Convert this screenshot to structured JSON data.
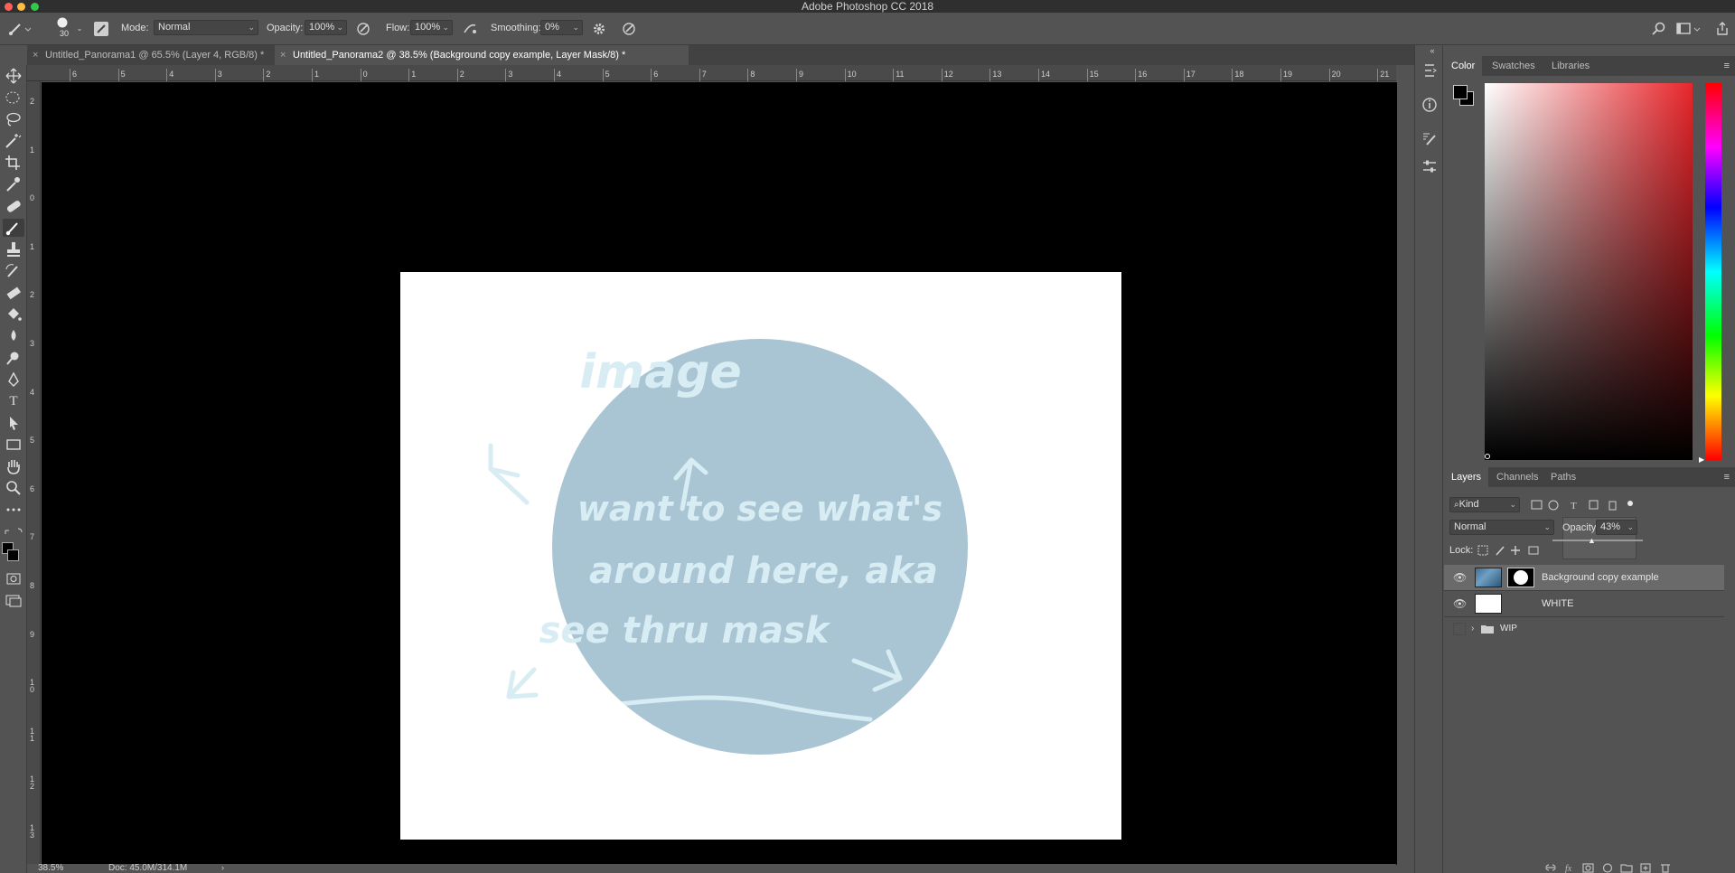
{
  "app": {
    "title": "Adobe Photoshop CC 2018"
  },
  "options_bar": {
    "brush_size": "30",
    "mode_label": "Mode:",
    "mode_value": "Normal",
    "opacity_label": "Opacity:",
    "opacity_value": "100%",
    "flow_label": "Flow:",
    "flow_value": "100%",
    "smoothing_label": "Smoothing:",
    "smoothing_value": "0%"
  },
  "tabs": [
    {
      "label": "Untitled_Panorama1 @ 65.5% (Layer 4, RGB/8) *",
      "active": false
    },
    {
      "label": "Untitled_Panorama2 @ 38.5% (Background copy example, Layer Mask/8) *",
      "active": true
    }
  ],
  "rulers": {
    "horizontal": [
      "6",
      "5",
      "4",
      "3",
      "2",
      "1",
      "0",
      "1",
      "2",
      "3",
      "4",
      "5",
      "6",
      "7",
      "8",
      "9",
      "10",
      "11",
      "12",
      "13",
      "14",
      "15",
      "16",
      "17",
      "18",
      "19",
      "20",
      "21"
    ],
    "vertical": [
      "2",
      "1",
      "0",
      "1",
      "2",
      "3",
      "4",
      "5",
      "6",
      "7",
      "8",
      "9",
      "1 0",
      "1 1",
      "1 2",
      "1 3"
    ]
  },
  "canvas": {
    "handwriting": [
      "image",
      "want to see what's",
      "around here, aka",
      "see thru mask"
    ]
  },
  "status": {
    "zoom": "38.5%",
    "doc": "Doc: 45.0M/314.1M"
  },
  "color_panel": {
    "tabs": [
      "Color",
      "Swatches",
      "Libraries"
    ],
    "active_tab": "Color",
    "hue_color": "#e8262b"
  },
  "layers_panel": {
    "tabs": [
      "Layers",
      "Channels",
      "Paths"
    ],
    "active_tab": "Layers",
    "filter_label": "Kind",
    "blend_mode": "Normal",
    "opacity_label": "Opacity:",
    "opacity_value": "43%",
    "opacity_fraction": 0.43,
    "lock_label": "Lock:",
    "layers": [
      {
        "name": "Background copy example",
        "visible": true,
        "selected": true,
        "has_mask": true
      },
      {
        "name": "WHITE",
        "visible": true,
        "selected": false
      },
      {
        "name": "WIP",
        "visible": false,
        "selected": false,
        "is_group": true
      }
    ]
  }
}
